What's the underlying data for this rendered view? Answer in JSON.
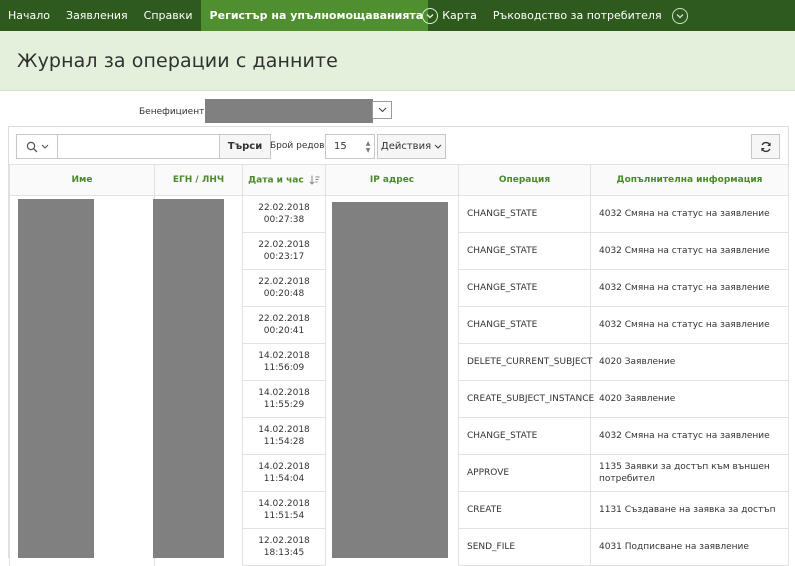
{
  "nav": {
    "items": [
      {
        "label": "Начало"
      },
      {
        "label": "Заявления"
      },
      {
        "label": "Справки"
      },
      {
        "label": "Регистър на упълномощаванията",
        "active": true
      },
      {
        "label": "Карта"
      },
      {
        "label": "Ръководство за потребителя"
      }
    ]
  },
  "page": {
    "title": "Журнал за операции с данните"
  },
  "filter": {
    "beneficiary_label": "Бенефициент:"
  },
  "toolbar": {
    "search_placeholder": "",
    "go_label": "Търси",
    "rows_label": "Брой редове",
    "rows_value": "15",
    "actions_label": "Действия"
  },
  "table": {
    "columns": [
      "Име",
      "ЕГН / ЛНЧ",
      "Дата и час",
      "IP адрес",
      "Операция",
      "Допълнителна информация"
    ],
    "rows": [
      {
        "date": "22.02.2018",
        "time": "00:27:38",
        "operation": "CHANGE_STATE",
        "info": "4032 Смяна на статус на заявление"
      },
      {
        "date": "22.02.2018",
        "time": "00:23:17",
        "operation": "CHANGE_STATE",
        "info": "4032 Смяна на статус на заявление"
      },
      {
        "date": "22.02.2018",
        "time": "00:20:48",
        "operation": "CHANGE_STATE",
        "info": "4032 Смяна на статус на заявление"
      },
      {
        "date": "22.02.2018",
        "time": "00:20:41",
        "operation": "CHANGE_STATE",
        "info": "4032 Смяна на статус на заявление"
      },
      {
        "date": "14.02.2018",
        "time": "11:56:09",
        "operation": "DELETE_CURRENT_SUBJECT",
        "info": "4020 Заявление"
      },
      {
        "date": "14.02.2018",
        "time": "11:55:29",
        "operation": "CREATE_SUBJECT_INSTANCE",
        "info": "4020 Заявление"
      },
      {
        "date": "14.02.2018",
        "time": "11:54:28",
        "operation": "CHANGE_STATE",
        "info": "4032 Смяна на статус на заявление"
      },
      {
        "date": "14.02.2018",
        "time": "11:54:04",
        "operation": "APPROVE",
        "info": "1135 Заявки за достъп към външен потребител"
      },
      {
        "date": "14.02.2018",
        "time": "11:51:54",
        "operation": "CREATE",
        "info": "1131 Създаване на заявка за достъп"
      },
      {
        "date": "12.02.2018",
        "time": "18:13:45",
        "operation": "SEND_FILE",
        "info": "4031 Подписване на заявление"
      }
    ]
  },
  "colors": {
    "nav_bg": "#2e5a1e",
    "nav_active": "#4f8f30",
    "header_bg": "#e3f1dc",
    "column_header_text": "#4a8a2a",
    "redaction": "#808080"
  }
}
